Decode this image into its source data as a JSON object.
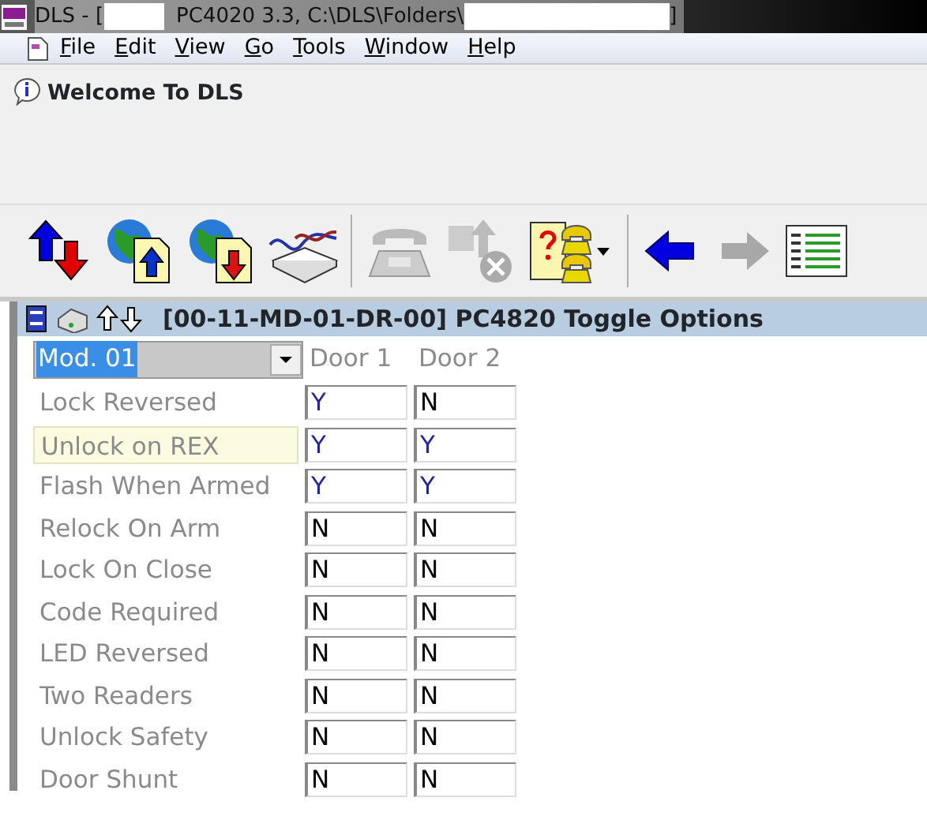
{
  "window": {
    "title_parts": [
      "DLS - [",
      "PC4020 3.3, C:\\DLS\\Folders\\",
      "]"
    ]
  },
  "menu": [
    "File",
    "Edit",
    "View",
    "Go",
    "Tools",
    "Window",
    "Help"
  ],
  "welcome": "Welcome To DLS",
  "toolbar": [
    {
      "kind": "updown",
      "disabled": false
    },
    {
      "kind": "globe-up",
      "disabled": false
    },
    {
      "kind": "globe-down",
      "disabled": false
    },
    {
      "kind": "modem",
      "disabled": false
    },
    {
      "kind": "sep"
    },
    {
      "kind": "phone",
      "disabled": true
    },
    {
      "kind": "hangup",
      "disabled": true
    },
    {
      "kind": "phonebook",
      "disabled": false
    },
    {
      "kind": "sep"
    },
    {
      "kind": "back",
      "disabled": false
    },
    {
      "kind": "forward",
      "disabled": true
    },
    {
      "kind": "grid",
      "disabled": false
    }
  ],
  "panel": {
    "title": "[00-11-MD-01-DR-00] PC4820 Toggle Options",
    "module": "Mod. 01",
    "columns": [
      "Door 1",
      "Door 2"
    ],
    "rows": [
      {
        "label": "Lock Reversed",
        "highlighted": false,
        "cells": [
          {
            "text": "Y",
            "on": true
          },
          {
            "text": "N",
            "on": false
          }
        ]
      },
      {
        "label": "Unlock on REX",
        "highlighted": true,
        "cells": [
          {
            "text": "Y",
            "on": true
          },
          {
            "text": "Y",
            "on": true
          }
        ]
      },
      {
        "label": "Flash When Armed",
        "highlighted": false,
        "cells": [
          {
            "text": "Y",
            "on": true
          },
          {
            "text": "Y",
            "on": true
          }
        ]
      },
      {
        "label": "Relock On Arm",
        "highlighted": false,
        "cells": [
          {
            "text": "N",
            "on": false
          },
          {
            "text": "N",
            "on": false
          }
        ]
      },
      {
        "label": "Lock On Close",
        "highlighted": false,
        "cells": [
          {
            "text": "N",
            "on": false
          },
          {
            "text": "N",
            "on": false
          }
        ]
      },
      {
        "label": "Code Required",
        "highlighted": false,
        "cells": [
          {
            "text": "N",
            "on": false
          },
          {
            "text": "N",
            "on": false
          }
        ]
      },
      {
        "label": "LED Reversed",
        "highlighted": false,
        "cells": [
          {
            "text": "N",
            "on": false
          },
          {
            "text": "N",
            "on": false
          }
        ]
      },
      {
        "label": "Two Readers",
        "highlighted": false,
        "cells": [
          {
            "text": "N",
            "on": false
          },
          {
            "text": "N",
            "on": false
          }
        ]
      },
      {
        "label": "Unlock Safety",
        "highlighted": false,
        "cells": [
          {
            "text": "N",
            "on": false
          },
          {
            "text": "N",
            "on": false
          }
        ]
      },
      {
        "label": "Door Shunt",
        "highlighted": false,
        "cells": [
          {
            "text": "N",
            "on": false
          },
          {
            "text": "N",
            "on": false
          }
        ]
      }
    ]
  }
}
